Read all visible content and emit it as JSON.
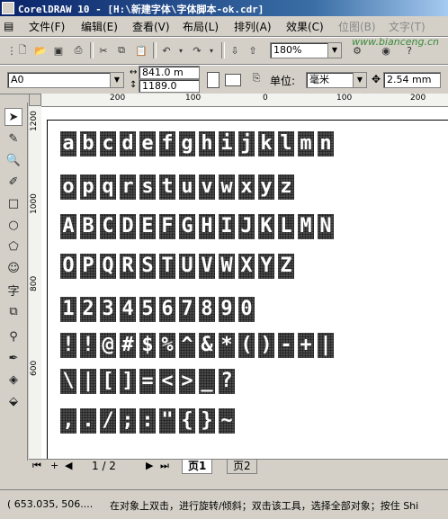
{
  "window": {
    "title": "CorelDRAW 10 - [H:\\新建字体\\字体脚本-ok.cdr]"
  },
  "menu": {
    "items": [
      "文件(F)",
      "编辑(E)",
      "查看(V)",
      "布局(L)",
      "排列(A)",
      "效果(C)",
      "位图(B)",
      "文字(T)"
    ],
    "watermark": "www.bianceng.cn"
  },
  "standard_toolbar": {
    "zoom_value": "180%"
  },
  "property_bar": {
    "paper_size": "A0",
    "width_value": "841.0 m",
    "height_value": "1189.0",
    "units_label": "单位:",
    "units_value": "毫米",
    "nudge_value": "2.54 mm"
  },
  "rulers": {
    "h_ticks": [
      "200",
      "100",
      "0",
      "100",
      "200"
    ],
    "v_ticks": [
      "1200",
      "1000",
      "800",
      "600"
    ]
  },
  "canvas": {
    "rows": [
      [
        "a",
        "b",
        "c",
        "d",
        "e",
        "f",
        "g",
        "h",
        "i",
        "j",
        "k",
        "l",
        "m",
        "n"
      ],
      [
        "o",
        "p",
        "q",
        "r",
        "s",
        "t",
        "u",
        "v",
        "w",
        "x",
        "y",
        "z"
      ],
      [
        "A",
        "B",
        "C",
        "D",
        "E",
        "F",
        "G",
        "H",
        "I",
        "J",
        "K",
        "L",
        "M",
        "N"
      ],
      [
        "O",
        "P",
        "Q",
        "R",
        "S",
        "T",
        "U",
        "V",
        "W",
        "X",
        "Y",
        "Z"
      ],
      [
        "1",
        "2",
        "3",
        "4",
        "5",
        "6",
        "7",
        "8",
        "9",
        "0"
      ],
      [
        "!",
        "!",
        "@",
        "#",
        "$",
        "%",
        "^",
        "&",
        "*",
        "(",
        ")",
        "-",
        "+",
        "|"
      ],
      [
        "\\",
        "|",
        "[",
        "]",
        "=",
        "<",
        ">",
        "_",
        "?"
      ],
      [
        ",",
        ".",
        "/",
        ";",
        ":",
        "\"",
        "{",
        "}",
        "~"
      ]
    ]
  },
  "page_tabs": {
    "page_counter": "1 / 2",
    "tabs": [
      "页1",
      "页2"
    ]
  },
  "status_bar": {
    "coordinates": "( 653.035, 506....",
    "hint": "在对象上双击，进行旋转/倾斜；双击该工具，选择全部对象；按住 Shi"
  }
}
